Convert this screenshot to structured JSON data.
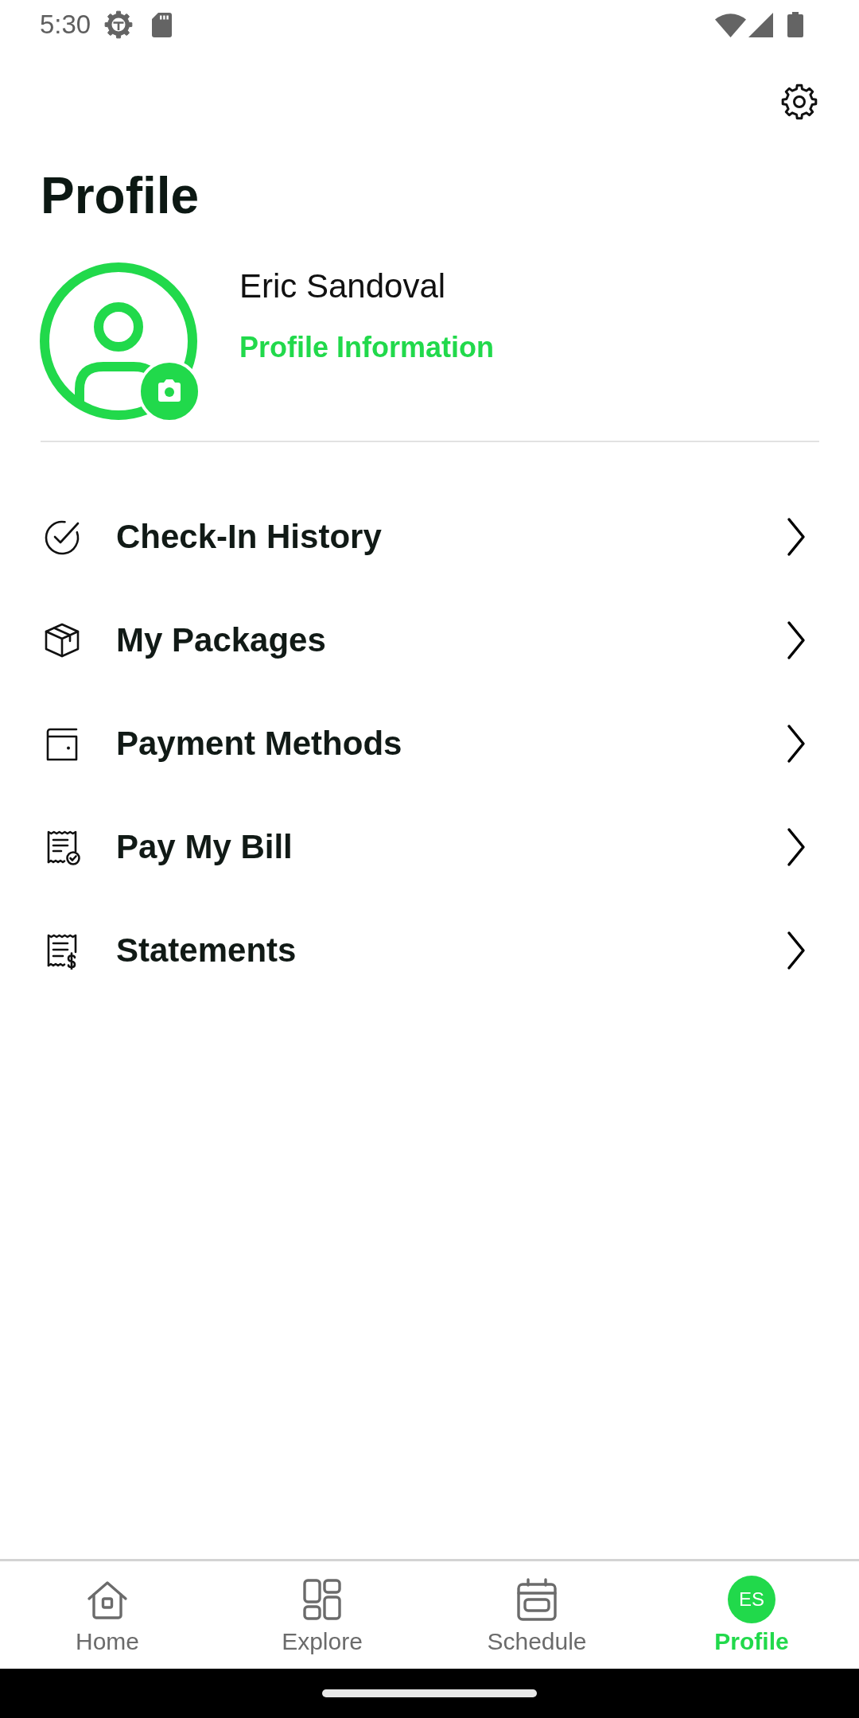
{
  "status_bar": {
    "time": "5:30"
  },
  "header": {
    "title": "Profile"
  },
  "profile": {
    "name": "Eric Sandoval",
    "link": "Profile Information"
  },
  "menu": [
    {
      "label": "Check-In History"
    },
    {
      "label": "My Packages"
    },
    {
      "label": "Payment Methods"
    },
    {
      "label": "Pay My Bill"
    },
    {
      "label": "Statements"
    }
  ],
  "bottom_nav": [
    {
      "label": "Home",
      "selected": false
    },
    {
      "label": "Explore",
      "selected": false
    },
    {
      "label": "Schedule",
      "selected": false
    },
    {
      "label": "Profile",
      "selected": true,
      "initials": "ES"
    }
  ]
}
